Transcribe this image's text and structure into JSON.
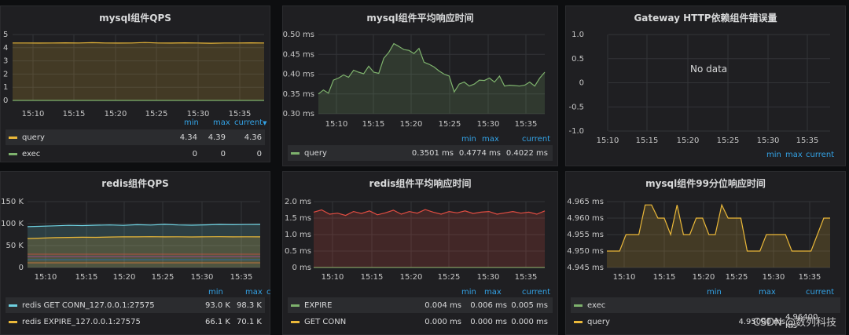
{
  "panels": {
    "p1": {
      "title": "mysql组件QPS",
      "chart_data": {
        "type": "line",
        "x_ticks": [
          "15:10",
          "15:15",
          "15:20",
          "15:25",
          "15:30",
          "15:35"
        ],
        "y_ticks": [
          "5",
          "4",
          "3",
          "2",
          "1",
          "0"
        ],
        "ylim": [
          0,
          5
        ],
        "series": [
          {
            "name": "query",
            "color": "#eab839",
            "values": [
              4.36,
              4.36,
              4.35,
              4.36,
              4.37,
              4.36,
              4.38,
              4.36,
              4.35,
              4.36,
              4.39,
              4.36,
              4.35,
              4.37,
              4.36,
              4.34,
              4.36,
              4.36,
              4.37,
              4.36
            ]
          },
          {
            "name": "exec",
            "color": "#7eb26d",
            "values": [
              0,
              0,
              0,
              0,
              0,
              0,
              0,
              0,
              0,
              0,
              0,
              0,
              0,
              0,
              0,
              0,
              0,
              0,
              0,
              0
            ]
          }
        ]
      },
      "legend_headers": [
        "min",
        "max",
        "current"
      ],
      "legend_rows": [
        {
          "name": "query",
          "color": "#eab839",
          "min": "4.34",
          "max": "4.39",
          "current": "4.36"
        },
        {
          "name": "exec",
          "color": "#7eb26d",
          "min": "0",
          "max": "0",
          "current": "0"
        }
      ]
    },
    "p2": {
      "title": "mysql组件平均响应时间",
      "chart_data": {
        "type": "area",
        "x_ticks": [
          "15:10",
          "15:15",
          "15:20",
          "15:25",
          "15:30",
          "15:35"
        ],
        "y_ticks": [
          "0.50 ms",
          "0.45 ms",
          "0.40 ms",
          "0.35 ms",
          "0.30 ms"
        ],
        "ylim": [
          0.3,
          0.5
        ],
        "series": [
          {
            "name": "query",
            "color": "#7eb26d",
            "values": [
              0.35,
              0.36,
              0.352,
              0.385,
              0.39,
              0.398,
              0.392,
              0.41,
              0.405,
              0.401,
              0.42,
              0.405,
              0.402,
              0.44,
              0.455,
              0.477,
              0.47,
              0.462,
              0.46,
              0.452,
              0.465,
              0.43,
              0.425,
              0.418,
              0.408,
              0.4,
              0.395,
              0.355,
              0.375,
              0.38,
              0.37,
              0.375,
              0.385,
              0.384,
              0.39,
              0.38,
              0.395,
              0.37,
              0.372,
              0.371,
              0.37,
              0.372,
              0.38,
              0.37,
              0.39,
              0.405
            ]
          }
        ]
      },
      "legend_headers": [
        "min",
        "max",
        "current"
      ],
      "legend_rows": [
        {
          "name": "query",
          "color": "#7eb26d",
          "min": "0.3501 ms",
          "max": "0.4774 ms",
          "current": "0.4022 ms"
        }
      ]
    },
    "p3": {
      "title": "Gateway HTTP依赖组件错误量",
      "no_data": "No data",
      "chart_data": {
        "type": "line",
        "x_ticks": [
          "15:10",
          "15:15",
          "15:20",
          "15:25",
          "15:30",
          "15:35"
        ],
        "y_ticks": [
          "1.0",
          "0.5",
          "0",
          "-0.5",
          "-1.0"
        ],
        "ylim": [
          -1.0,
          1.0
        ],
        "series": []
      },
      "legend_headers": [
        "min",
        "max",
        "current"
      ]
    },
    "p4": {
      "title": "redis组件QPS",
      "chart_data": {
        "type": "line",
        "x_ticks": [
          "15:10",
          "15:15",
          "15:20",
          "15:25",
          "15:30",
          "15:35"
        ],
        "y_ticks": [
          "150 K",
          "100 K",
          "50 K",
          "0"
        ],
        "ylim": [
          0,
          150000
        ],
        "series": [
          {
            "name": "redis GET CONN_127.0.0.1:27575",
            "color": "#6ed0e0",
            "values": [
              93000,
              94000,
              95000,
              96000,
              95500,
              96500,
              97000,
              96000,
              97500,
              96800,
              98300,
              97000,
              96500,
              97200,
              98000,
              97500,
              97800,
              98000
            ]
          },
          {
            "name": "redis EXPIRE_127.0.0.1:27575",
            "color": "#eab839",
            "values": [
              66100,
              67000,
              68000,
              68500,
              69000,
              68800,
              69500,
              70000,
              69800,
              70100,
              69900,
              70000,
              69700,
              70000,
              70100,
              69900,
              70000,
              69800
            ]
          }
        ]
      },
      "legend_headers": [
        "min",
        "max",
        "c"
      ],
      "legend_rows": [
        {
          "name": "redis GET CONN_127.0.0.1:27575",
          "color": "#6ed0e0",
          "min": "93.0 K",
          "max": "98.3 K"
        },
        {
          "name": "redis EXPIRE_127.0.0.1:27575",
          "color": "#eab839",
          "min": "66.1 K",
          "max": "70.1 K"
        }
      ]
    },
    "p5": {
      "title": "redis组件平均响应时间",
      "chart_data": {
        "type": "area",
        "x_ticks": [
          "15:10",
          "15:15",
          "15:20",
          "15:25",
          "15:30",
          "15:35"
        ],
        "y_ticks": [
          "2.0 ms",
          "1.5 ms",
          "1.0 ms",
          "0.5 ms",
          "0 ms"
        ],
        "ylim": [
          0,
          2.0
        ],
        "series": [
          {
            "name": "EXPIRE",
            "color": "#7eb26d",
            "values": [
              0.005,
              0.005,
              0.005,
              0.005,
              0.005,
              0.005,
              0.005,
              0.005,
              0.005,
              0.005
            ]
          },
          {
            "name": "GET CONN",
            "color": "#e24d42",
            "values": [
              1.68,
              1.75,
              1.62,
              1.65,
              1.58,
              1.7,
              1.64,
              1.72,
              1.6,
              1.66,
              1.74,
              1.62,
              1.7,
              1.65,
              1.76,
              1.68,
              1.62,
              1.7,
              1.66,
              1.72,
              1.64,
              1.68,
              1.7,
              1.62,
              1.66,
              1.7,
              1.65,
              1.68,
              1.62,
              1.72
            ]
          }
        ]
      },
      "legend_headers": [
        "min",
        "max",
        "current"
      ],
      "legend_rows": [
        {
          "name": "EXPIRE",
          "color": "#7eb26d",
          "min": "0.004 ms",
          "max": "0.006 ms",
          "current": "0.005 ms"
        },
        {
          "name": "GET CONN",
          "color": "#eab839",
          "min": "0.000 ms",
          "max": "0.000 ms",
          "current": "0.000 ms"
        }
      ]
    },
    "p6": {
      "title": "mysql组件99分位响应时间",
      "chart_data": {
        "type": "area",
        "x_ticks": [
          "15:10",
          "15:15",
          "15:20",
          "15:25",
          "15:30",
          "15:35"
        ],
        "y_ticks": [
          "4.965 ms",
          "4.960 ms",
          "4.955 ms",
          "4.950 ms",
          "4.945 ms"
        ],
        "ylim": [
          4.945,
          4.965
        ],
        "series": [
          {
            "name": "query",
            "color": "#eab839",
            "values": [
              4.95,
              4.95,
              4.95,
              4.955,
              4.955,
              4.955,
              4.964,
              4.964,
              4.96,
              4.96,
              4.955,
              4.964,
              4.955,
              4.955,
              4.96,
              4.96,
              4.955,
              4.955,
              4.964,
              4.96,
              4.96,
              4.96,
              4.95,
              4.95,
              4.95,
              4.955,
              4.955,
              4.955,
              4.955,
              4.95,
              4.95,
              4.95,
              4.95,
              4.955,
              4.96,
              4.96
            ]
          },
          {
            "name": "exec",
            "color": "#7eb26d",
            "values": []
          }
        ]
      },
      "legend_headers": [
        "min",
        "max",
        "current"
      ],
      "legend_rows": [
        {
          "name": "exec",
          "color": "#7eb26d"
        },
        {
          "name": "query",
          "color": "#eab839",
          "min": "4.95000 ms",
          "max": "4.96400 ms"
        }
      ]
    }
  },
  "watermark": "CSDN @数列科技"
}
